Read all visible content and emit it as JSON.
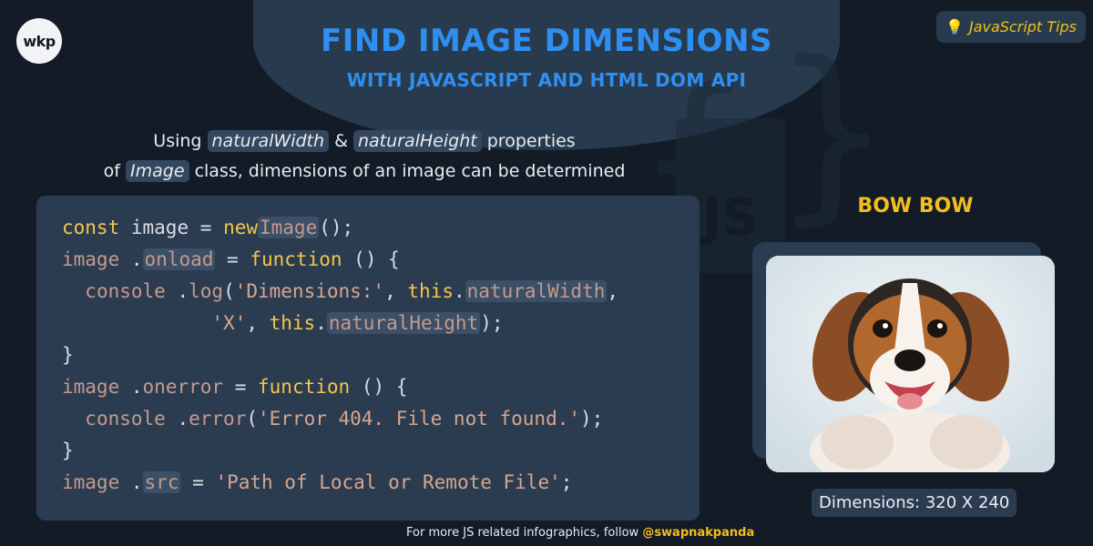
{
  "brand": {
    "logo_text": "wkp"
  },
  "header": {
    "title_line1": "Find Image Dimensions",
    "title_line2": "with JavaScript and HTML DOM API"
  },
  "tips_badge": {
    "label": "JavaScript Tips",
    "icon": "lightbulb-icon"
  },
  "intro": {
    "line1_prefix": "Using",
    "prop1": "naturalWidth",
    "amp": "&",
    "prop2": "naturalHeight",
    "line1_suffix": "properties",
    "line2_prefix": "of",
    "class_name": "Image",
    "line2_suffix": "class, dimensions of an image can be determined"
  },
  "code": {
    "l1": {
      "const": "const",
      "var": "image",
      "eq": "=",
      "new": "new",
      "cls": "Image",
      "rest": "();"
    },
    "l2": {
      "var": "image",
      "dot": ".",
      "prop": "onload",
      "eq": "=",
      "fn": "function",
      "rest": "() {"
    },
    "l3": {
      "indent": "  ",
      "obj": "console",
      "dot": ".",
      "method": "log",
      "open": "(",
      "str": "'Dimensions:'",
      "comma": ",",
      "this": "this",
      "dot2": ".",
      "prop": "naturalWidth",
      "tail": ","
    },
    "l4": {
      "indent": "             ",
      "str": "'X'",
      "comma": ",",
      "this": "this",
      "dot": ".",
      "prop": "naturalHeight",
      "tail": ");"
    },
    "l5": {
      "text": "}"
    },
    "l6": {
      "var": "image",
      "dot": ".",
      "prop": "onerror",
      "eq": "=",
      "fn": "function",
      "rest": "() {"
    },
    "l7": {
      "indent": "  ",
      "obj": "console",
      "dot": ".",
      "method": "error",
      "open": "(",
      "str": "'Error 404. File not found.'",
      "tail": ");"
    },
    "l8": {
      "text": "}"
    },
    "l9": {
      "var": "image",
      "dot": ".",
      "prop": "src",
      "eq": "=",
      "str": "'Path of Local or Remote File'",
      "tail": ";"
    }
  },
  "example": {
    "title": "Bow Bow",
    "dimensions": "Dimensions: 320 X 240"
  },
  "footer": {
    "text": "For more JS related infographics, follow",
    "handle": "@swapnakpanda"
  },
  "colors": {
    "background": "#131b27",
    "panel": "#2b3c51",
    "title_blue": "#2f8ff0",
    "accent_yellow": "#f2bd1e"
  }
}
